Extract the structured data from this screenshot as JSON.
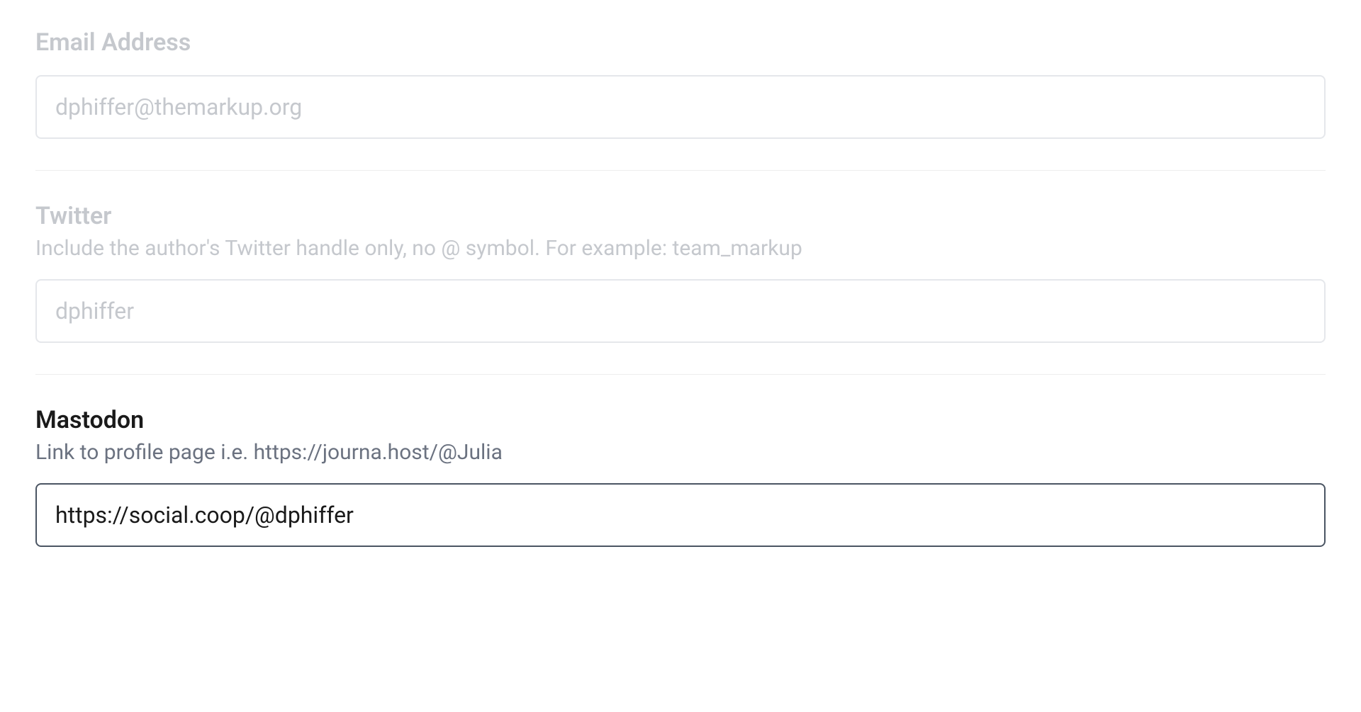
{
  "fields": {
    "email": {
      "label": "Email Address",
      "value": "dphiffer@themarkup.org"
    },
    "twitter": {
      "label": "Twitter",
      "help": "Include the author's Twitter handle only, no @ symbol. For example: team_markup",
      "value": "dphiffer"
    },
    "mastodon": {
      "label": "Mastodon",
      "help": "Link to profile page i.e. https://journa.host/@Julia",
      "value": "https://social.coop/@dphiffer"
    }
  }
}
